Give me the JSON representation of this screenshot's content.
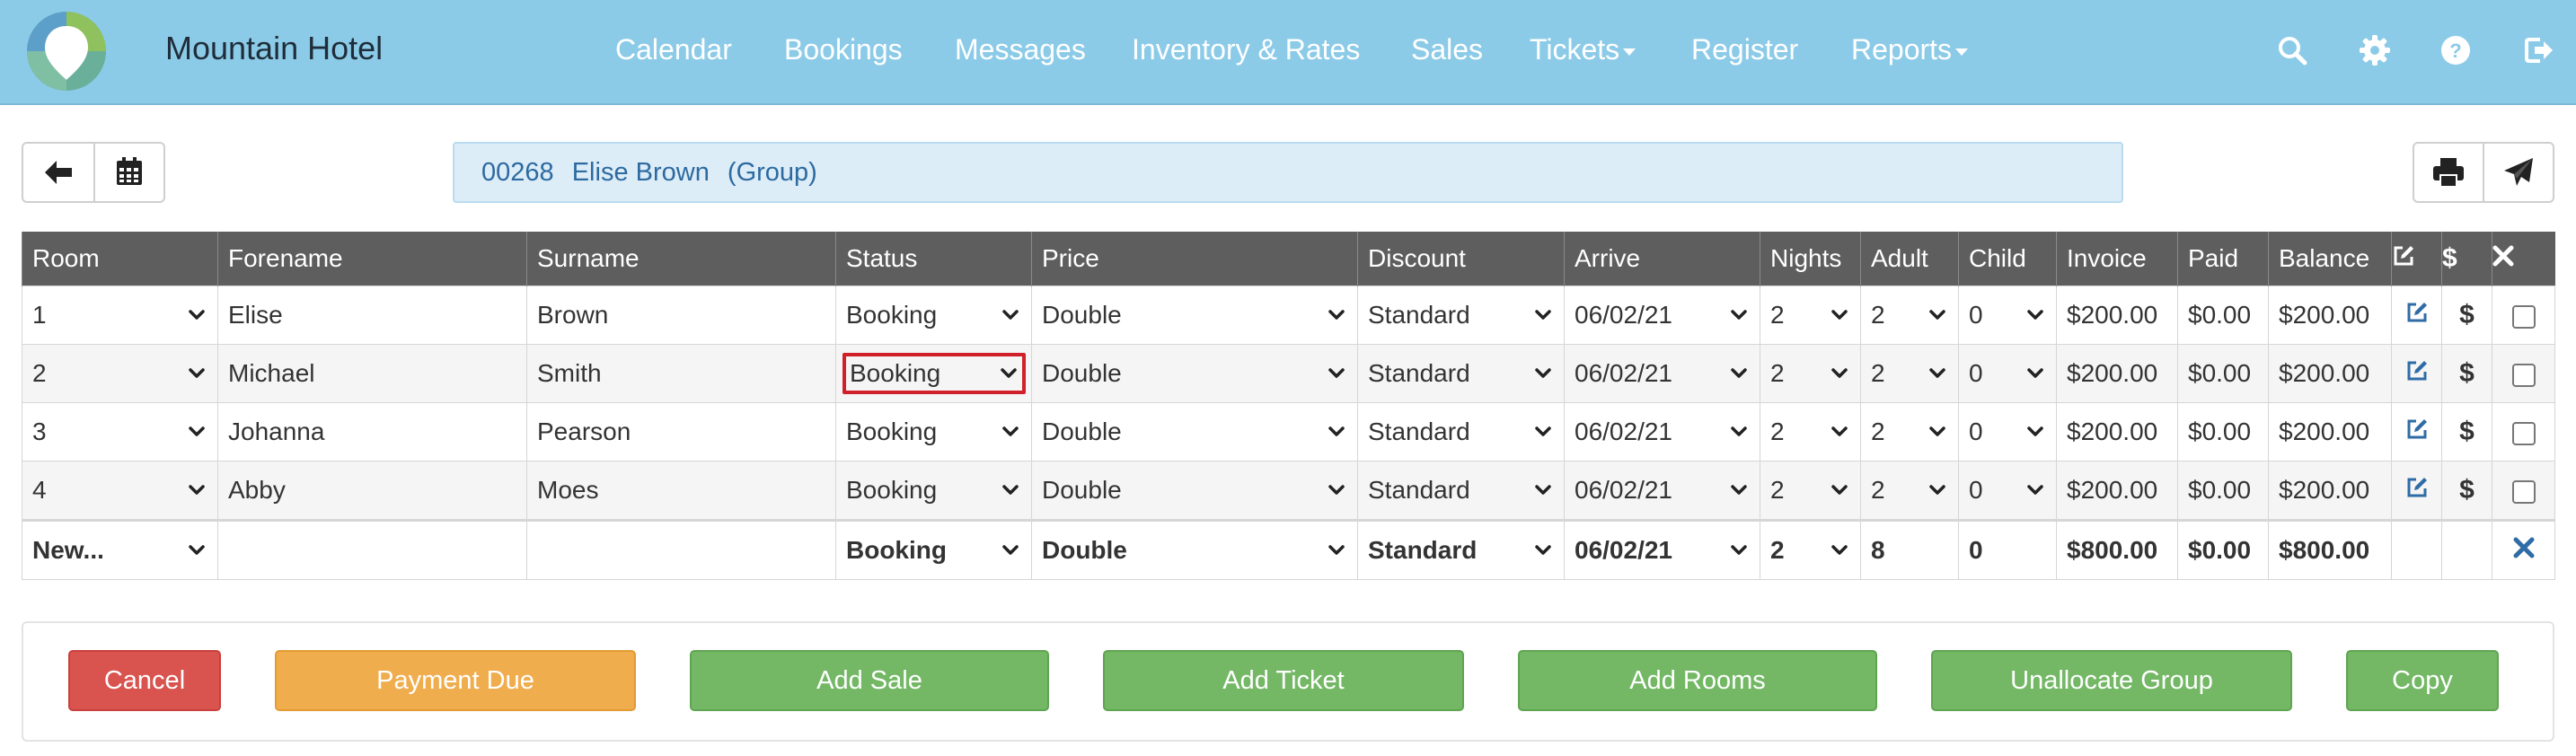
{
  "brand": {
    "name": "Mountain Hotel",
    "logo_icon": "hotel-logo-icon"
  },
  "nav": {
    "items": [
      {
        "label": "Calendar"
      },
      {
        "label": "Bookings"
      },
      {
        "label": "Messages"
      },
      {
        "label": "Inventory & Rates"
      },
      {
        "label": "Sales"
      },
      {
        "label": "Tickets",
        "dropdown": true
      },
      {
        "label": "Register"
      },
      {
        "label": "Reports",
        "dropdown": true
      }
    ],
    "icons": [
      "search-icon",
      "gear-icon",
      "help-icon",
      "logout-icon"
    ]
  },
  "group": {
    "number": "00268",
    "name": "Elise Brown",
    "type": "(Group)"
  },
  "table": {
    "headers": [
      "Room",
      "Forename",
      "Surname",
      "Status",
      "Price",
      "Discount",
      "Arrive",
      "Nights",
      "Adult",
      "Child",
      "Invoice",
      "Paid",
      "Balance"
    ],
    "rows": [
      {
        "room": "1",
        "forename": "Elise",
        "surname": "Brown",
        "status": "Booking",
        "price": "Double",
        "discount": "Standard",
        "arrive": "06/02/21",
        "nights": "2",
        "adult": "2",
        "child": "0",
        "invoice": "$200.00",
        "paid": "$0.00",
        "balance": "$200.00"
      },
      {
        "room": "2",
        "forename": "Michael",
        "surname": "Smith",
        "status": "Booking",
        "price": "Double",
        "discount": "Standard",
        "arrive": "06/02/21",
        "nights": "2",
        "adult": "2",
        "child": "0",
        "invoice": "$200.00",
        "paid": "$0.00",
        "balance": "$200.00"
      },
      {
        "room": "3",
        "forename": "Johanna",
        "surname": "Pearson",
        "status": "Booking",
        "price": "Double",
        "discount": "Standard",
        "arrive": "06/02/21",
        "nights": "2",
        "adult": "2",
        "child": "0",
        "invoice": "$200.00",
        "paid": "$0.00",
        "balance": "$200.00"
      },
      {
        "room": "4",
        "forename": "Abby",
        "surname": "Moes",
        "status": "Booking",
        "price": "Double",
        "discount": "Standard",
        "arrive": "06/02/21",
        "nights": "2",
        "adult": "2",
        "child": "0",
        "invoice": "$200.00",
        "paid": "$0.00",
        "balance": "$200.00"
      }
    ],
    "new_row": {
      "room": "New...",
      "status": "Booking",
      "price": "Double",
      "discount": "Standard",
      "arrive": "06/02/21",
      "nights": "2",
      "adult": "8",
      "child": "0",
      "invoice": "$800.00",
      "paid": "$0.00",
      "balance": "$800.00"
    }
  },
  "footer": {
    "cancel": "Cancel",
    "payment_due": "Payment Due",
    "add_sale": "Add Sale",
    "add_ticket": "Add Ticket",
    "add_rooms": "Add Rooms",
    "unallocate_group": "Unallocate Group",
    "copy": "Copy"
  },
  "colors": {
    "navbar": "#8ccbe8",
    "header": "#5e5e5e",
    "link": "#2f6ca6",
    "danger": "#d9534f",
    "warning": "#f0ad4e",
    "success": "#74b866",
    "highlight": "#d0202a"
  }
}
